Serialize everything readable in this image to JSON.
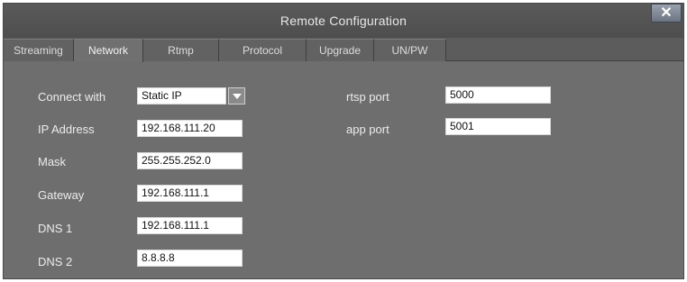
{
  "window": {
    "title": "Remote Configuration",
    "close_glyph": "✕"
  },
  "tabs": [
    {
      "label": "Streaming"
    },
    {
      "label": "Network"
    },
    {
      "label": "Rtmp"
    },
    {
      "label": "Protocol"
    },
    {
      "label": "Upgrade"
    },
    {
      "label": "UN/PW"
    }
  ],
  "active_tab": "Network",
  "network": {
    "connect_with_label": "Connect with",
    "connect_with_value": "Static IP",
    "ip_address_label": "IP Address",
    "ip_address_value": "192.168.111.20",
    "mask_label": "Mask",
    "mask_value": "255.255.252.0",
    "gateway_label": "Gateway",
    "gateway_value": "192.168.111.1",
    "dns1_label": "DNS 1",
    "dns1_value": "192.168.111.1",
    "dns2_label": "DNS 2",
    "dns2_value": "8.8.8.8",
    "rtsp_port_label": "rtsp port",
    "rtsp_port_value": "5000",
    "app_port_label": "app port",
    "app_port_value": "5001"
  },
  "colors": {
    "window_bg": "#6e6e6e",
    "titlebar_bg": "#545454",
    "tab_active_bg": "#707070",
    "field_bg": "#ffffff"
  }
}
